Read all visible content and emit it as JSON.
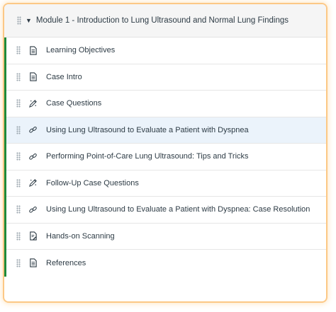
{
  "module": {
    "title": "Module 1 - Introduction to Lung Ultrasound and Normal Lung Findings",
    "caret_icon": "caret-down-icon"
  },
  "items": [
    {
      "label": "Learning Objectives",
      "icon": "page-icon"
    },
    {
      "label": "Case Intro",
      "icon": "page-icon"
    },
    {
      "label": "Case Questions",
      "icon": "quiz-icon"
    },
    {
      "label": "Using Lung Ultrasound to Evaluate a Patient with Dyspnea",
      "icon": "link-icon",
      "highlighted": true
    },
    {
      "label": "Performing Point-of-Care Lung Ultrasound: Tips and Tricks",
      "icon": "link-icon"
    },
    {
      "label": "Follow-Up Case Questions",
      "icon": "quiz-icon"
    },
    {
      "label": "Using Lung Ultrasound to Evaluate a Patient with Dyspnea: Case Resolution",
      "icon": "link-icon"
    },
    {
      "label": "Hands-on Scanning",
      "icon": "assignment-icon"
    },
    {
      "label": "References",
      "icon": "page-icon"
    }
  ],
  "colors": {
    "published_bar": "#1e8a3a",
    "highlight_row": "#ebf3fb",
    "frame_glow": "#f9aa46",
    "text": "#2d3b45"
  }
}
